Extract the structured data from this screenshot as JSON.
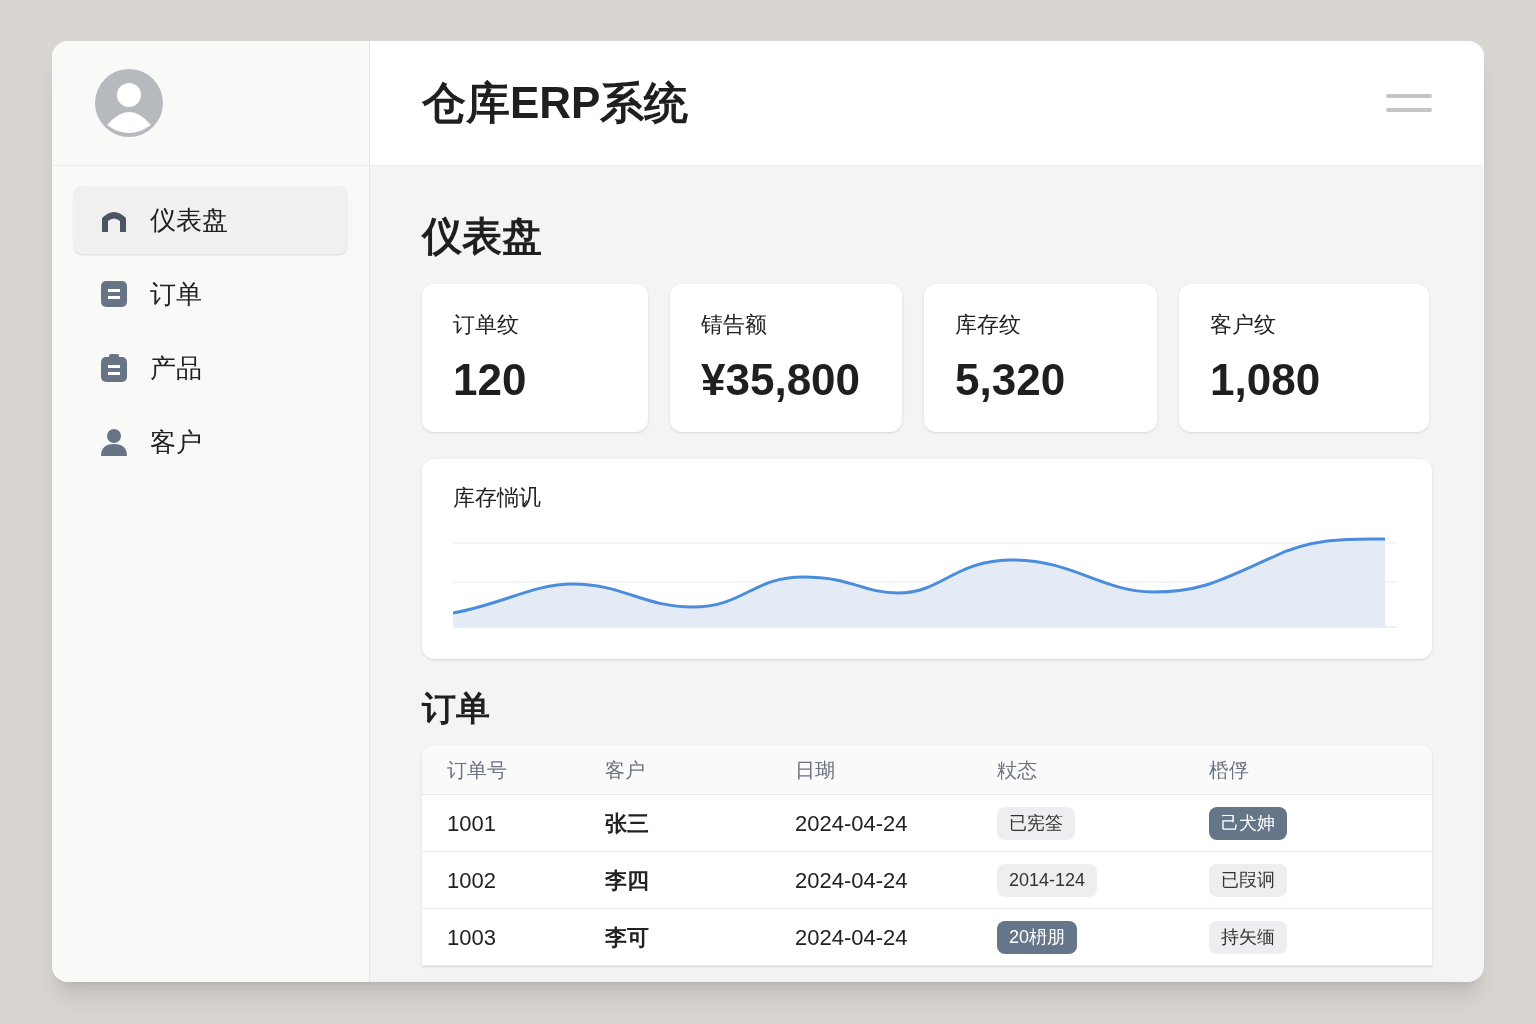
{
  "header": {
    "title": "仓库ERP系统"
  },
  "sidebar": {
    "items": [
      {
        "label": "仪表盘",
        "kind": "home",
        "selected": true
      },
      {
        "label": "订单",
        "kind": "doc",
        "selected": false
      },
      {
        "label": "产品",
        "kind": "clipboard",
        "selected": false
      },
      {
        "label": "客户",
        "kind": "person",
        "selected": false
      }
    ]
  },
  "page_title": "仪表盘",
  "stats": [
    {
      "label": "订单纹",
      "value": "120"
    },
    {
      "label": "锖告额",
      "value": "¥35,800"
    },
    {
      "label": "库存纹",
      "value": "5,320"
    },
    {
      "label": "客户纹",
      "value": "1,080"
    }
  ],
  "inventory_chart": {
    "title": "库存惝讥"
  },
  "orders": {
    "title": "订单",
    "columns": [
      "订单号",
      "客户",
      "日瑚",
      "粀态",
      "桰俘"
    ],
    "rows": [
      {
        "id": "1001",
        "customer": "张三",
        "date": "2024-04-24",
        "status": {
          "text": "已宪筌",
          "kind": "light"
        },
        "action": {
          "text": "己犬妽",
          "kind": "dark"
        }
      },
      {
        "id": "1002",
        "customer": "李四",
        "date": "2024-04-24",
        "status": {
          "text": "2014-124",
          "kind": "light"
        },
        "action": {
          "text": "已叚诇",
          "kind": "light"
        }
      },
      {
        "id": "1003",
        "customer": "李可",
        "date": "2024-04-24",
        "status": {
          "text": "20枬朋",
          "kind": "dark"
        },
        "action": {
          "text": "持矢缅",
          "kind": "light"
        }
      }
    ]
  }
}
